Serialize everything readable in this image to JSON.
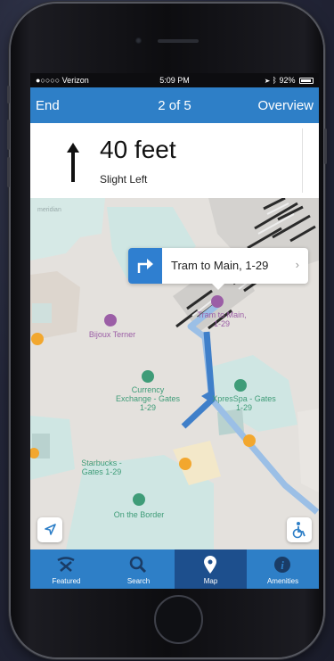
{
  "status_bar": {
    "carrier": "●○○○○ Verizon",
    "time": "5:09 PM",
    "battery": "92%"
  },
  "nav": {
    "end": "End",
    "step": "2 of 5",
    "overview": "Overview"
  },
  "direction": {
    "distance": "40 feet",
    "instruction": "Slight Left"
  },
  "map": {
    "watermark": "meridian",
    "labels": {
      "bijoux": "Bijoux Terner",
      "currency": "Currency\nExchange - Gates\n1-29",
      "spa": "XpresSpa - Gates\n1-29",
      "starbucks": "Starbucks -\nGates 1-29",
      "border": "On the Border",
      "tram": "Tram to Main,\n1-29"
    },
    "callout": "Tram to Main, 1-29"
  },
  "tabs": [
    {
      "label": "Featured",
      "icon": "featured-icon"
    },
    {
      "label": "Search",
      "icon": "search-icon"
    },
    {
      "label": "Map",
      "icon": "map-pin-icon"
    },
    {
      "label": "Amenities",
      "icon": "info-icon"
    }
  ],
  "colors": {
    "accent": "#2e7fc7",
    "tab_active": "#1d4f8d",
    "route": "#3f7fc9"
  }
}
